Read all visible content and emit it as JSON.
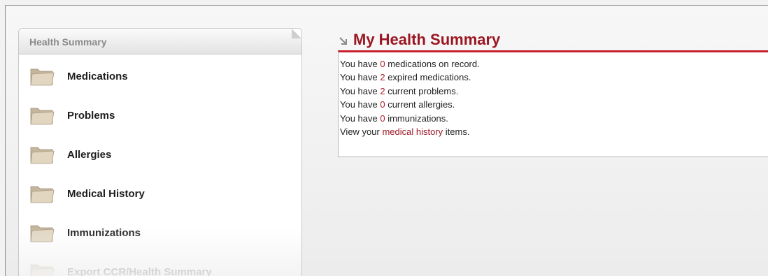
{
  "sidebar": {
    "header": "Health Summary",
    "items": [
      {
        "label": "Medications",
        "icon": "folder-icon",
        "enabled": true
      },
      {
        "label": "Problems",
        "icon": "folder-icon",
        "enabled": true
      },
      {
        "label": "Allergies",
        "icon": "folder-icon",
        "enabled": true
      },
      {
        "label": "Medical History",
        "icon": "folder-icon",
        "enabled": true
      },
      {
        "label": "Immunizations",
        "icon": "folder-icon",
        "enabled": true
      },
      {
        "label": "Export CCR/Health Summary",
        "icon": "folder-icon",
        "enabled": false
      }
    ]
  },
  "main": {
    "title": "My Health Summary",
    "title_icon": "arrow-down-right-icon",
    "lines": [
      {
        "prefix": "You have ",
        "value": "0",
        "suffix": " medications on record."
      },
      {
        "prefix": "You have ",
        "value": "2",
        "suffix": " expired medications."
      },
      {
        "prefix": "You have ",
        "value": "2",
        "suffix": " current problems."
      },
      {
        "prefix": "You have ",
        "value": "0",
        "suffix": " current allergies."
      },
      {
        "prefix": "You have ",
        "value": "0",
        "suffix": " immunizations."
      }
    ],
    "history_line": {
      "prefix": "View your ",
      "link": "medical history",
      "suffix": " items."
    }
  },
  "colors": {
    "accent": "#9b1622",
    "rule": "#c8202d",
    "value": "#b01c2a",
    "folder": "#d8ccb8"
  }
}
